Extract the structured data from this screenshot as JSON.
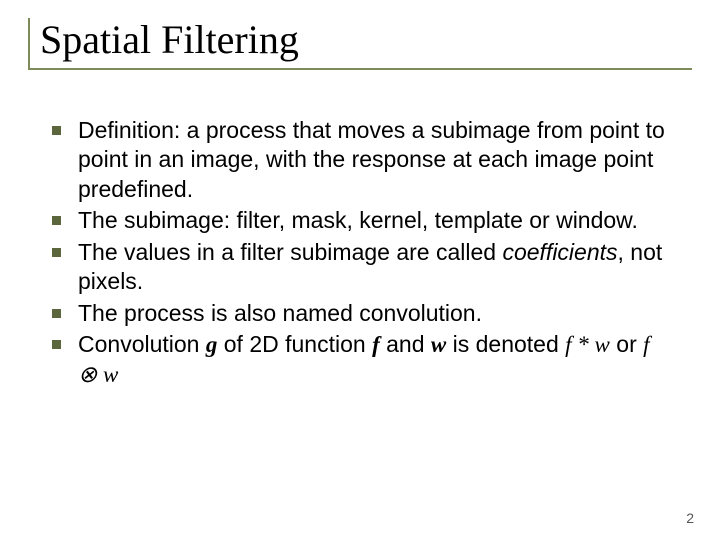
{
  "title": "Spatial Filtering",
  "bullets": {
    "b1": "Definition: a process that moves a subimage from point to point in an image, with the response at each image point predefined.",
    "b2": "The subimage: filter, mask, kernel, template or window.",
    "b3a": "The values in a filter subimage are called ",
    "b3b": "coefficients",
    "b3c": ", not pixels.",
    "b4": "The process is also named convolution.",
    "b5a": "Convolution ",
    "b5b": " of 2D function ",
    "b5c": " and ",
    "b5d": " is denoted ",
    "b5e": " or "
  },
  "math": {
    "g": "g",
    "f": "f",
    "w": "w",
    "fw_star": "f * w",
    "fw_otimes": "f ⊗ w"
  },
  "page": "2"
}
